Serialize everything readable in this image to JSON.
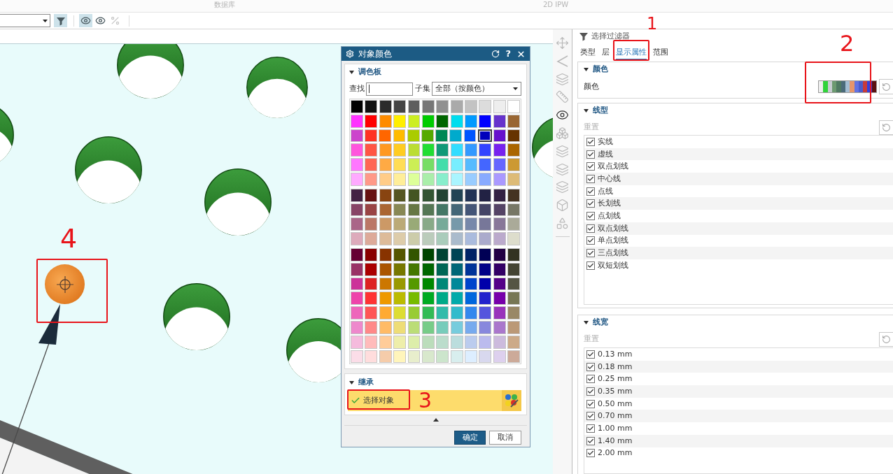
{
  "ribbon": {
    "groups": [
      "数据库",
      "2D IPW"
    ]
  },
  "toolbar": {
    "buttons": [
      {
        "kind": "filter",
        "pressed": true,
        "disabled": false
      },
      {
        "kind": "show_hide",
        "pressed": true,
        "disabled": false
      },
      {
        "kind": "hide",
        "pressed": false,
        "disabled": false
      },
      {
        "kind": "percent",
        "pressed": false,
        "disabled": true
      }
    ]
  },
  "dialog": {
    "title": "对象颜色",
    "help": "?",
    "palette_section": {
      "title": "调色板",
      "expanded": true,
      "search_label": "查找",
      "subset_label": "子集",
      "subset_value": "全部（按颜色）",
      "rows": [
        {
          "swatches": [
            {
              "color": "#000000",
              "selected": false
            },
            {
              "color": "#111111",
              "selected": false
            },
            {
              "color": "#2b2b2b",
              "selected": false
            },
            {
              "color": "#444444",
              "selected": false
            },
            {
              "color": "#5e5e5e",
              "selected": false
            },
            {
              "color": "#777777",
              "selected": false
            },
            {
              "color": "#909090",
              "selected": false
            },
            {
              "color": "#aaaaaa",
              "selected": false
            },
            {
              "color": "#c3c3c3",
              "selected": false
            },
            {
              "color": "#dcdcdc",
              "selected": false
            },
            {
              "color": "#eeeeee",
              "selected": false
            },
            {
              "color": "#ffffff",
              "selected": false
            }
          ]
        },
        {
          "swatches": [
            {
              "color": "#ff33ff",
              "selected": false
            },
            {
              "color": "#ff0000",
              "selected": false
            },
            {
              "color": "#ff8c00",
              "selected": false
            },
            {
              "color": "#ffee00",
              "selected": false
            },
            {
              "color": "#ccee22",
              "selected": false
            },
            {
              "color": "#00cc00",
              "selected": false
            },
            {
              "color": "#006600",
              "selected": false
            },
            {
              "color": "#00ddee",
              "selected": false
            },
            {
              "color": "#0099ff",
              "selected": false
            },
            {
              "color": "#0000ff",
              "selected": false
            },
            {
              "color": "#6633cc",
              "selected": false
            },
            {
              "color": "#996633",
              "selected": false
            }
          ]
        },
        {
          "swatches": [
            {
              "color": "#cc44cc",
              "selected": false
            },
            {
              "color": "#ff3322",
              "selected": false
            },
            {
              "color": "#ff6600",
              "selected": false
            },
            {
              "color": "#ffbb00",
              "selected": false
            },
            {
              "color": "#aacc00",
              "selected": false
            },
            {
              "color": "#55aa00",
              "selected": false
            },
            {
              "color": "#008855",
              "selected": false
            },
            {
              "color": "#00aacc",
              "selected": false
            },
            {
              "color": "#0055ff",
              "selected": false
            },
            {
              "color": "#0000bb",
              "selected": true
            },
            {
              "color": "#6611cc",
              "selected": false
            },
            {
              "color": "#663300",
              "selected": false
            }
          ]
        },
        {
          "swatches": [
            {
              "color": "#ff55dd",
              "selected": false
            },
            {
              "color": "#ff5544",
              "selected": false
            },
            {
              "color": "#ff9922",
              "selected": false
            },
            {
              "color": "#ffcc22",
              "selected": false
            },
            {
              "color": "#bbdd33",
              "selected": false
            },
            {
              "color": "#22dd33",
              "selected": false
            },
            {
              "color": "#119977",
              "selected": false
            },
            {
              "color": "#33ddff",
              "selected": false
            },
            {
              "color": "#3399ff",
              "selected": false
            },
            {
              "color": "#3344ff",
              "selected": false
            },
            {
              "color": "#7722ee",
              "selected": false
            },
            {
              "color": "#aa6600",
              "selected": false
            }
          ]
        },
        {
          "swatches": [
            {
              "color": "#ff77ff",
              "selected": false
            },
            {
              "color": "#ff6655",
              "selected": false
            },
            {
              "color": "#ffaa44",
              "selected": false
            },
            {
              "color": "#ffdd55",
              "selected": false
            },
            {
              "color": "#ccee55",
              "selected": false
            },
            {
              "color": "#77dd66",
              "selected": false
            },
            {
              "color": "#44ddaa",
              "selected": false
            },
            {
              "color": "#77eeff",
              "selected": false
            },
            {
              "color": "#55bbff",
              "selected": false
            },
            {
              "color": "#4466ff",
              "selected": false
            },
            {
              "color": "#6666ff",
              "selected": false
            },
            {
              "color": "#cc9933",
              "selected": false
            }
          ]
        },
        {
          "swatches": [
            {
              "color": "#ffaaff",
              "selected": false
            },
            {
              "color": "#ff9988",
              "selected": false
            },
            {
              "color": "#ffcc88",
              "selected": false
            },
            {
              "color": "#ffee99",
              "selected": false
            },
            {
              "color": "#ddff99",
              "selected": false
            },
            {
              "color": "#aaeeaa",
              "selected": false
            },
            {
              "color": "#88eecc",
              "selected": false
            },
            {
              "color": "#aaf5ff",
              "selected": false
            },
            {
              "color": "#99ccff",
              "selected": false
            },
            {
              "color": "#88aaff",
              "selected": false
            },
            {
              "color": "#aa99ff",
              "selected": false
            },
            {
              "color": "#ddbb77",
              "selected": false
            }
          ]
        },
        {
          "swatches": [
            {
              "color": "#442244",
              "selected": false
            },
            {
              "color": "#661111",
              "selected": false
            },
            {
              "color": "#884411",
              "selected": false
            },
            {
              "color": "#555522",
              "selected": false
            },
            {
              "color": "#445522",
              "selected": false
            },
            {
              "color": "#335533",
              "selected": false
            },
            {
              "color": "#224433",
              "selected": false
            },
            {
              "color": "#224455",
              "selected": false
            },
            {
              "color": "#223355",
              "selected": false
            },
            {
              "color": "#222244",
              "selected": false
            },
            {
              "color": "#332244",
              "selected": false
            },
            {
              "color": "#443322",
              "selected": false
            }
          ]
        },
        {
          "swatches": [
            {
              "color": "#884466",
              "selected": false
            },
            {
              "color": "#994444",
              "selected": false
            },
            {
              "color": "#aa6633",
              "selected": false
            },
            {
              "color": "#888855",
              "selected": false
            },
            {
              "color": "#667744",
              "selected": false
            },
            {
              "color": "#557755",
              "selected": false
            },
            {
              "color": "#447766",
              "selected": false
            },
            {
              "color": "#446677",
              "selected": false
            },
            {
              "color": "#445577",
              "selected": false
            },
            {
              "color": "#444466",
              "selected": false
            },
            {
              "color": "#554466",
              "selected": false
            },
            {
              "color": "#777766",
              "selected": false
            }
          ]
        },
        {
          "swatches": [
            {
              "color": "#aa6688",
              "selected": false
            },
            {
              "color": "#bb7766",
              "selected": false
            },
            {
              "color": "#cc9966",
              "selected": false
            },
            {
              "color": "#bbaa77",
              "selected": false
            },
            {
              "color": "#99aa77",
              "selected": false
            },
            {
              "color": "#88aa88",
              "selected": false
            },
            {
              "color": "#77aa99",
              "selected": false
            },
            {
              "color": "#7799aa",
              "selected": false
            },
            {
              "color": "#7788aa",
              "selected": false
            },
            {
              "color": "#777799",
              "selected": false
            },
            {
              "color": "#887799",
              "selected": false
            },
            {
              "color": "#aaaa99",
              "selected": false
            }
          ]
        },
        {
          "swatches": [
            {
              "color": "#ddaabb",
              "selected": false
            },
            {
              "color": "#ddaa99",
              "selected": false
            },
            {
              "color": "#ddbb99",
              "selected": false
            },
            {
              "color": "#ddccaa",
              "selected": false
            },
            {
              "color": "#ccccaa",
              "selected": false
            },
            {
              "color": "#bbccbb",
              "selected": false
            },
            {
              "color": "#aaccbb",
              "selected": false
            },
            {
              "color": "#aabbcc",
              "selected": false
            },
            {
              "color": "#aabbdd",
              "selected": false
            },
            {
              "color": "#aaaacc",
              "selected": false
            },
            {
              "color": "#bbaacc",
              "selected": false
            },
            {
              "color": "#ddddcc",
              "selected": false
            }
          ]
        },
        {
          "swatches": [
            {
              "color": "#660033",
              "selected": false
            },
            {
              "color": "#880000",
              "selected": false
            },
            {
              "color": "#883300",
              "selected": false
            },
            {
              "color": "#555500",
              "selected": false
            },
            {
              "color": "#335500",
              "selected": false
            },
            {
              "color": "#004400",
              "selected": false
            },
            {
              "color": "#004433",
              "selected": false
            },
            {
              "color": "#004455",
              "selected": false
            },
            {
              "color": "#002266",
              "selected": false
            },
            {
              "color": "#000055",
              "selected": false
            },
            {
              "color": "#220044",
              "selected": false
            },
            {
              "color": "#333322",
              "selected": false
            }
          ]
        },
        {
          "swatches": [
            {
              "color": "#993366",
              "selected": false
            },
            {
              "color": "#aa0000",
              "selected": false
            },
            {
              "color": "#aa5500",
              "selected": false
            },
            {
              "color": "#777700",
              "selected": false
            },
            {
              "color": "#447700",
              "selected": false
            },
            {
              "color": "#006600",
              "selected": false
            },
            {
              "color": "#006655",
              "selected": false
            },
            {
              "color": "#006677",
              "selected": false
            },
            {
              "color": "#003399",
              "selected": false
            },
            {
              "color": "#000088",
              "selected": false
            },
            {
              "color": "#330066",
              "selected": false
            },
            {
              "color": "#444433",
              "selected": false
            }
          ]
        },
        {
          "swatches": [
            {
              "color": "#cc3399",
              "selected": false
            },
            {
              "color": "#dd2222",
              "selected": false
            },
            {
              "color": "#cc7700",
              "selected": false
            },
            {
              "color": "#999900",
              "selected": false
            },
            {
              "color": "#559900",
              "selected": false
            },
            {
              "color": "#008800",
              "selected": false
            },
            {
              "color": "#008877",
              "selected": false
            },
            {
              "color": "#008899",
              "selected": false
            },
            {
              "color": "#0044cc",
              "selected": false
            },
            {
              "color": "#0000aa",
              "selected": false
            },
            {
              "color": "#550088",
              "selected": false
            },
            {
              "color": "#555544",
              "selected": false
            }
          ]
        },
        {
          "swatches": [
            {
              "color": "#ee44aa",
              "selected": false
            },
            {
              "color": "#ff3333",
              "selected": false
            },
            {
              "color": "#ee9900",
              "selected": false
            },
            {
              "color": "#bbbb00",
              "selected": false
            },
            {
              "color": "#77bb00",
              "selected": false
            },
            {
              "color": "#00aa22",
              "selected": false
            },
            {
              "color": "#00aa88",
              "selected": false
            },
            {
              "color": "#00aaaa",
              "selected": false
            },
            {
              "color": "#0066dd",
              "selected": false
            },
            {
              "color": "#2222cc",
              "selected": false
            },
            {
              "color": "#7700aa",
              "selected": false
            },
            {
              "color": "#777755",
              "selected": false
            }
          ]
        },
        {
          "swatches": [
            {
              "color": "#ee66bb",
              "selected": false
            },
            {
              "color": "#ff5555",
              "selected": false
            },
            {
              "color": "#ffaa33",
              "selected": false
            },
            {
              "color": "#dddd33",
              "selected": false
            },
            {
              "color": "#99cc33",
              "selected": false
            },
            {
              "color": "#33bb55",
              "selected": false
            },
            {
              "color": "#33bbaa",
              "selected": false
            },
            {
              "color": "#33bbcc",
              "selected": false
            },
            {
              "color": "#3388ee",
              "selected": false
            },
            {
              "color": "#5555dd",
              "selected": false
            },
            {
              "color": "#9933bb",
              "selected": false
            },
            {
              "color": "#998866",
              "selected": false
            }
          ]
        },
        {
          "swatches": [
            {
              "color": "#ee88cc",
              "selected": false
            },
            {
              "color": "#ff8888",
              "selected": false
            },
            {
              "color": "#ffbb66",
              "selected": false
            },
            {
              "color": "#eedd77",
              "selected": false
            },
            {
              "color": "#bbdd77",
              "selected": false
            },
            {
              "color": "#77cc88",
              "selected": false
            },
            {
              "color": "#77ccbb",
              "selected": false
            },
            {
              "color": "#77ccdd",
              "selected": false
            },
            {
              "color": "#77aaee",
              "selected": false
            },
            {
              "color": "#8888dd",
              "selected": false
            },
            {
              "color": "#aa77cc",
              "selected": false
            },
            {
              "color": "#bb9977",
              "selected": false
            }
          ]
        },
        {
          "swatches": [
            {
              "color": "#f5bbdd",
              "selected": false
            },
            {
              "color": "#ffbbbb",
              "selected": false
            },
            {
              "color": "#ffcc99",
              "selected": false
            },
            {
              "color": "#eeeeaa",
              "selected": false
            },
            {
              "color": "#ddeeaa",
              "selected": false
            },
            {
              "color": "#bbddbb",
              "selected": false
            },
            {
              "color": "#bbddcc",
              "selected": false
            },
            {
              "color": "#bbdddd",
              "selected": false
            },
            {
              "color": "#bbccee",
              "selected": false
            },
            {
              "color": "#bbbbee",
              "selected": false
            },
            {
              "color": "#ccbbdd",
              "selected": false
            },
            {
              "color": "#ccaa88",
              "selected": false
            }
          ]
        },
        {
          "swatches": [
            {
              "color": "#fbdde8",
              "selected": false
            },
            {
              "color": "#ffdddd",
              "selected": false
            },
            {
              "color": "#f5ccaa",
              "selected": false
            },
            {
              "color": "#fff5bb",
              "selected": false
            },
            {
              "color": "#e8eecc",
              "selected": false
            },
            {
              "color": "#d8e8cc",
              "selected": false
            },
            {
              "color": "#cce5cc",
              "selected": false
            },
            {
              "color": "#d8eeee",
              "selected": false
            },
            {
              "color": "#ddeeff",
              "selected": false
            },
            {
              "color": "#d8d8ee",
              "selected": false
            },
            {
              "color": "#ddd0ee",
              "selected": false
            },
            {
              "color": "#ccaa99",
              "selected": false
            }
          ]
        }
      ]
    },
    "inherit_section": {
      "title": "继承",
      "expanded": true,
      "selection": {
        "label": "选择对象",
        "active": true,
        "complete": true
      }
    },
    "buttons": [
      {
        "label": "确定",
        "kind": "primary"
      },
      {
        "label": "取消",
        "kind": "secondary"
      }
    ]
  },
  "view_tools": [
    {
      "kind": "move",
      "disabled": true
    },
    {
      "kind": "angle",
      "disabled": true
    },
    {
      "kind": "layers",
      "disabled": true
    },
    {
      "kind": "ruler",
      "disabled": true
    },
    {
      "kind": "eye",
      "disabled": false
    },
    {
      "kind": "boxes",
      "disabled": true
    },
    {
      "kind": "layers",
      "disabled": true
    },
    {
      "kind": "layers",
      "disabled": true
    },
    {
      "kind": "layers",
      "disabled": true
    },
    {
      "kind": "box",
      "disabled": true
    },
    {
      "kind": "shapes",
      "disabled": true
    }
  ],
  "filter_panel": {
    "title": "选择过滤器",
    "tabs": [
      {
        "label": "类型",
        "selected": false
      },
      {
        "label": "层",
        "selected": false
      },
      {
        "label": "显示属性",
        "selected": true
      },
      {
        "label": "范围",
        "selected": false
      }
    ],
    "color_section": {
      "title": "颜色",
      "expanded": true,
      "label": "颜色",
      "stripes": [
        {
          "color": "#eeeeee"
        },
        {
          "color": "#2fd33a"
        },
        {
          "color": "#c8ccd2"
        },
        {
          "color": "#6c9a70"
        },
        {
          "color": "#4f7a62"
        },
        {
          "color": "#4b6b7a"
        },
        {
          "color": "#a3bdd3"
        },
        {
          "color": "#e7956a"
        },
        {
          "color": "#6272e2"
        },
        {
          "color": "#4b5ccc"
        },
        {
          "color": "#c83a3a"
        },
        {
          "color": "#3040e0"
        },
        {
          "color": "#5b1010"
        }
      ]
    },
    "line_type_section": {
      "title": "线型",
      "expanded": true,
      "reset": {
        "label": "重置",
        "disabled": true
      },
      "items": [
        {
          "label": "实线",
          "checked": true
        },
        {
          "label": "虚线",
          "checked": true
        },
        {
          "label": "双点划线",
          "checked": true
        },
        {
          "label": "中心线",
          "checked": true
        },
        {
          "label": "点线",
          "checked": true
        },
        {
          "label": "长划线",
          "checked": true
        },
        {
          "label": "点划线",
          "checked": true
        },
        {
          "label": "双点划线",
          "checked": true
        },
        {
          "label": "单点划线",
          "checked": true
        },
        {
          "label": "三点划线",
          "checked": true
        },
        {
          "label": "双短划线",
          "checked": true
        }
      ]
    },
    "line_width_section": {
      "title": "线宽",
      "expanded": true,
      "reset": {
        "label": "重置",
        "disabled": true
      },
      "items": [
        {
          "label": "0.13 mm",
          "checked": true
        },
        {
          "label": "0.18 mm",
          "checked": true
        },
        {
          "label": "0.25 mm",
          "checked": true
        },
        {
          "label": "0.35 mm",
          "checked": true
        },
        {
          "label": "0.50 mm",
          "checked": true
        },
        {
          "label": "0.70 mm",
          "checked": true
        },
        {
          "label": "1.00 mm",
          "checked": true
        },
        {
          "label": "1.40 mm",
          "checked": true
        },
        {
          "label": "2.00 mm",
          "checked": true
        }
      ]
    }
  },
  "annotations": [
    {
      "label": "1"
    },
    {
      "label": "2"
    },
    {
      "label": "3"
    },
    {
      "label": "4"
    }
  ]
}
